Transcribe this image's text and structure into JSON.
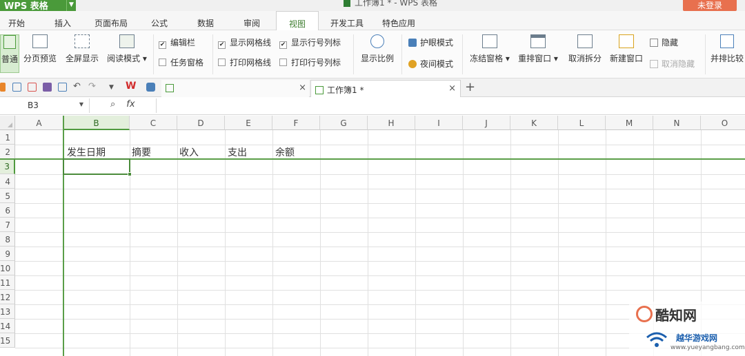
{
  "app": {
    "name": "WPS 表格",
    "window_title": "工作簿1 * - WPS 表格",
    "login_label": "未登录"
  },
  "menu": {
    "tabs": [
      "开始",
      "插入",
      "页面布局",
      "公式",
      "数据",
      "审阅",
      "视图",
      "开发工具",
      "特色应用"
    ],
    "active": "视图"
  },
  "ribbon": {
    "normal": "普通",
    "page_break": "分页预览",
    "fullscreen": "全屏显示",
    "reading_mode": "阅读模式",
    "edit_bar": "编辑栏",
    "task_pane": "任务窗格",
    "show_gridlines": "显示网格线",
    "print_gridlines": "打印网格线",
    "show_headings": "显示行号列标",
    "print_headings": "打印行号列标",
    "zoom": "显示比例",
    "eye_care": "护眼模式",
    "night_mode": "夜间模式",
    "freeze": "冻结窗格",
    "arrange": "重排窗口",
    "unsplit": "取消拆分",
    "new_window": "新建窗口",
    "hide": "隐藏",
    "unhide": "取消隐藏",
    "side_by_side": "并排比较"
  },
  "doc_tabs": {
    "active_tab": "工作簿1 *",
    "add": "+"
  },
  "formula_bar": {
    "name_box": "B3",
    "fx": "fx"
  },
  "sheet": {
    "columns": [
      "A",
      "B",
      "C",
      "D",
      "E",
      "F",
      "G",
      "H",
      "I",
      "J",
      "K",
      "L",
      "M",
      "N",
      "O"
    ],
    "rows": [
      "1",
      "2",
      "3",
      "4",
      "5",
      "6",
      "7",
      "8",
      "9",
      "10",
      "11",
      "12",
      "13",
      "14",
      "15"
    ],
    "selected_cell": "B3",
    "row2": {
      "B": "发生日期",
      "C": "摘要",
      "D": "收入",
      "E": "支出",
      "F": "余额"
    }
  },
  "watermark": {
    "brand": "酷知网",
    "sub": "越华游戏网",
    "url": "www.yueyangbang.com"
  },
  "colors": {
    "accent_green": "#4a9a3a",
    "login_orange": "#e8704e"
  }
}
